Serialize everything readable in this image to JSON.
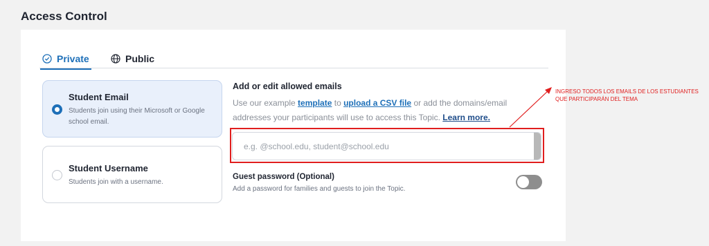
{
  "page": {
    "title": "Access Control"
  },
  "tabs": [
    {
      "label": "Private",
      "icon": "shield-check-icon",
      "active": true
    },
    {
      "label": "Public",
      "icon": "globe-icon",
      "active": false
    }
  ],
  "options": {
    "student_email": {
      "title": "Student Email",
      "description": "Students join using their Microsoft or Google school email.",
      "selected": true
    },
    "student_username": {
      "title": "Student Username",
      "description": "Students join with a username.",
      "selected": false
    }
  },
  "emails": {
    "heading": "Add or edit allowed emails",
    "desc_part1": "Use our example ",
    "template_link": "template",
    "desc_part2": " to ",
    "csv_link": "upload a CSV file",
    "desc_part3": " or add the domains/email addresses your participants will use to access this Topic. ",
    "learn_more": "Learn more.",
    "placeholder": "e.g. @school.edu, student@school.edu",
    "value": ""
  },
  "guest": {
    "title": "Guest password (Optional)",
    "description": "Add a password for families and guests to join the Topic.",
    "enabled": false
  },
  "annotation": {
    "text": "INGRESO TODOS LOS EMAILS DE LOS ESTUDIANTES QUE PARTICIPARÁN DEL TEMA",
    "color": "#e01e1e"
  },
  "colors": {
    "accent": "#1d6fb8",
    "selected_bg": "#e9f0fb",
    "annotation": "#e01e1e"
  }
}
